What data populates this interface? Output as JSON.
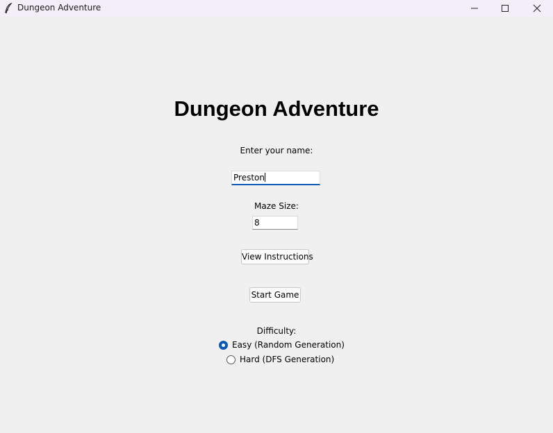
{
  "window": {
    "title": "Dungeon Adventure",
    "app_icon": "feather-icon"
  },
  "main": {
    "heading": "Dungeon Adventure",
    "name_label": "Enter your name:",
    "name_value": "Preston",
    "maze_label": "Maze Size:",
    "maze_value": "8",
    "view_instructions_label": "View Instructions",
    "start_game_label": "Start Game",
    "difficulty_label": "Difficulty:",
    "difficulty_options": [
      {
        "label": "Easy (Random Generation)",
        "selected": true
      },
      {
        "label": "Hard (DFS Generation)",
        "selected": false
      }
    ]
  },
  "colors": {
    "accent": "#0a5ab5",
    "background": "#f0f0f0",
    "titlebar": "#f3eff8"
  }
}
